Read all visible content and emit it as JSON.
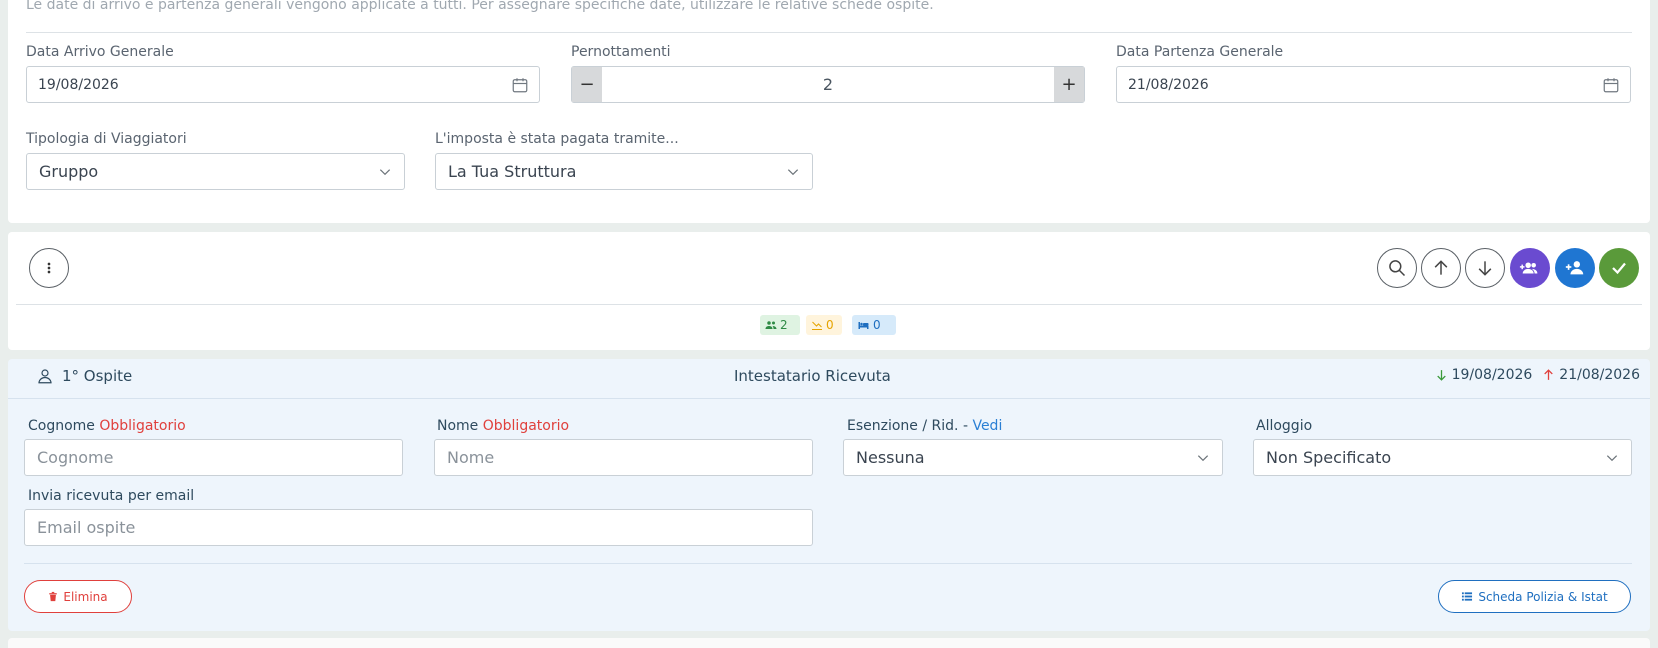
{
  "notice": "Le date di arrivo e partenza generali vengono applicate a tutti. Per assegnare specifiche date, utilizzare le relative schede ospite.",
  "general": {
    "arrival_label": "Data Arrivo Generale",
    "arrival_value": "19/08/2026",
    "nights_label": "Pernottamenti",
    "nights_value": "2",
    "minus": "−",
    "plus": "+",
    "departure_label": "Data Partenza Generale",
    "departure_value": "21/08/2026",
    "travelers_label": "Tipologia di Viaggiatori",
    "travelers_value": "Gruppo",
    "tax_label": "L'imposta è stata pagata tramite...",
    "tax_value": "La Tua Struttura"
  },
  "toolbar": {
    "badges": {
      "guests": "2",
      "exempt": "0",
      "beds": "0"
    }
  },
  "guest": {
    "title": "1° Ospite",
    "center": "Intestatario Ricevuta",
    "arrival": "19/08/2026",
    "departure": "21/08/2026",
    "surname_label": "Cognome",
    "required": "Obbligatorio",
    "surname_placeholder": "Cognome",
    "name_label": "Nome",
    "name_placeholder": "Nome",
    "exemption_label": "Esenzione / Rid. -",
    "exemption_link": "Vedi",
    "exemption_value": "Nessuna",
    "lodging_label": "Alloggio",
    "lodging_value": "Non Specificato",
    "email_label": "Invia ricevuta per email",
    "email_placeholder": "Email ospite",
    "delete_label": "Elimina",
    "scheda_label": "Scheda Polizia & Istat"
  },
  "colors": {
    "purple": "#6a4bd0",
    "blue": "#1f76d2",
    "green": "#5a9a3a",
    "required_red": "#e0403c"
  }
}
